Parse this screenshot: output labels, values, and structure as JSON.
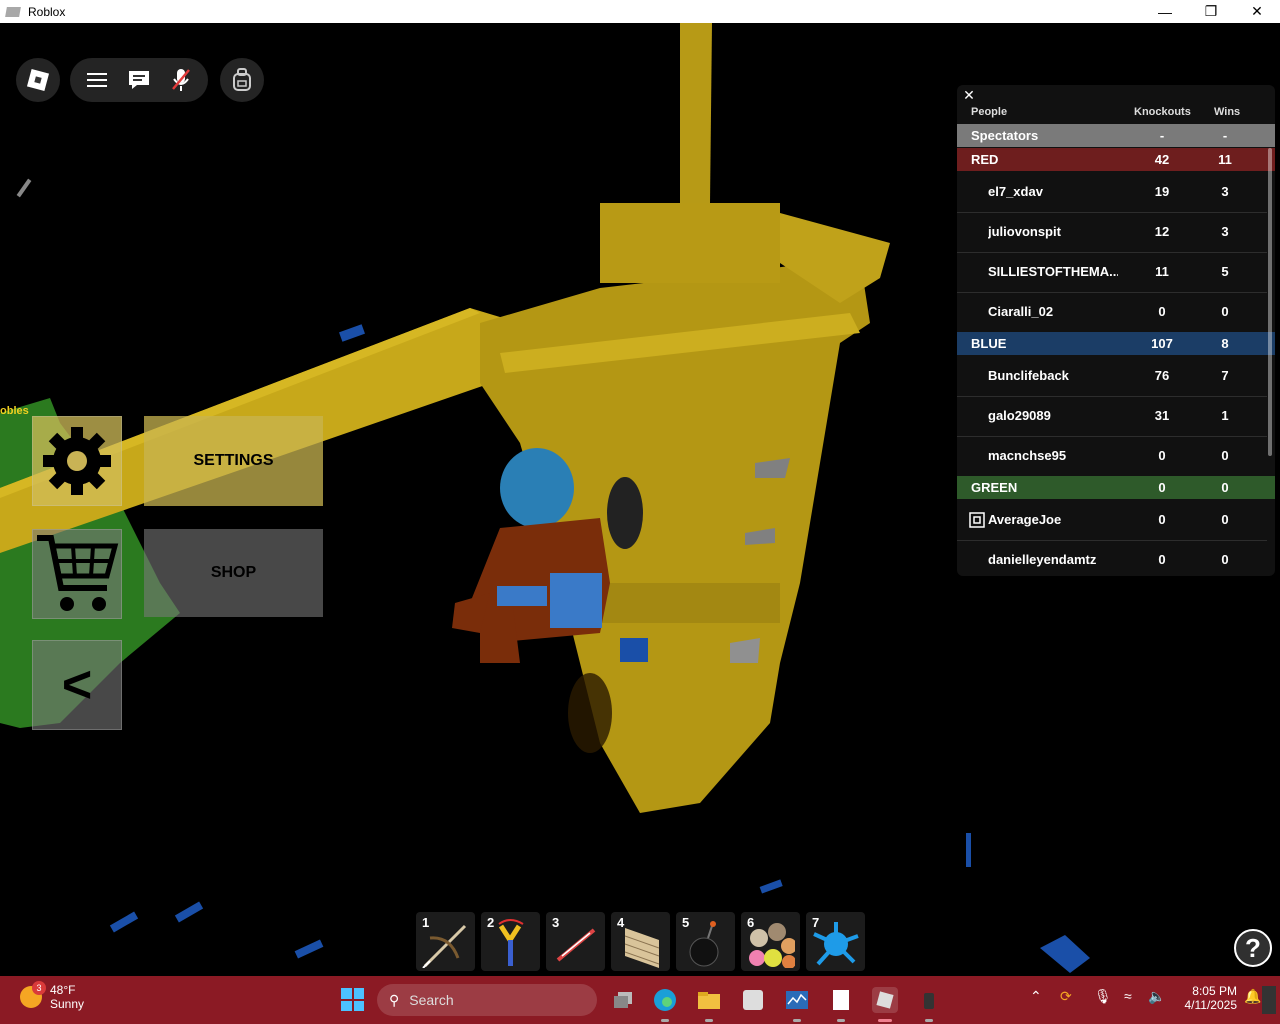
{
  "window": {
    "title": "Roblox",
    "min": "—",
    "max": "❐",
    "close": "✕"
  },
  "side_menu": {
    "settings_label": "SETTINGS",
    "shop_label": "SHOP",
    "back_label": "<"
  },
  "overhead_text": "obles",
  "leaderboard": {
    "close": "✕",
    "columns": {
      "people": "People",
      "knockouts": "Knockouts",
      "wins": "Wins"
    },
    "spectators": {
      "name": "Spectators",
      "knockouts": "-",
      "wins": "-"
    },
    "teams": [
      {
        "name": "RED",
        "knockouts": "42",
        "wins": "11",
        "color": "#6e1e1e",
        "players": [
          {
            "name": "el7_xdav",
            "knockouts": "19",
            "wins": "3"
          },
          {
            "name": "juliovonspit",
            "knockouts": "12",
            "wins": "3"
          },
          {
            "name": "SILLIESTOFTHEMA...",
            "knockouts": "11",
            "wins": "5"
          },
          {
            "name": "Ciaralli_02",
            "knockouts": "0",
            "wins": "0"
          }
        ]
      },
      {
        "name": "BLUE",
        "knockouts": "107",
        "wins": "8",
        "color": "#1b3d66",
        "players": [
          {
            "name": "Bunclifeback",
            "knockouts": "76",
            "wins": "7"
          },
          {
            "name": "galo29089",
            "knockouts": "31",
            "wins": "1"
          },
          {
            "name": "macnchse95",
            "knockouts": "0",
            "wins": "0"
          }
        ]
      },
      {
        "name": "GREEN",
        "knockouts": "0",
        "wins": "0",
        "color": "#2e5a2a",
        "players": [
          {
            "name": "AverageJoe",
            "knockouts": "0",
            "wins": "0"
          },
          {
            "name": "danielleyendamtz",
            "knockouts": "0",
            "wins": "0"
          }
        ]
      }
    ]
  },
  "hotbar": [
    {
      "num": "1",
      "icon": "crossbow-icon"
    },
    {
      "num": "2",
      "icon": "slingshot-icon"
    },
    {
      "num": "3",
      "icon": "sword-icon"
    },
    {
      "num": "4",
      "icon": "brick-wall-icon"
    },
    {
      "num": "5",
      "icon": "bomb-icon"
    },
    {
      "num": "6",
      "icon": "balls-icon"
    },
    {
      "num": "7",
      "icon": "paint-splat-icon"
    }
  ],
  "help": "?",
  "taskbar": {
    "weather": {
      "badge": "3",
      "temp": "48°F",
      "condition": "Sunny"
    },
    "search_placeholder": "Search",
    "time": "8:05 PM",
    "date": "4/11/2025"
  }
}
